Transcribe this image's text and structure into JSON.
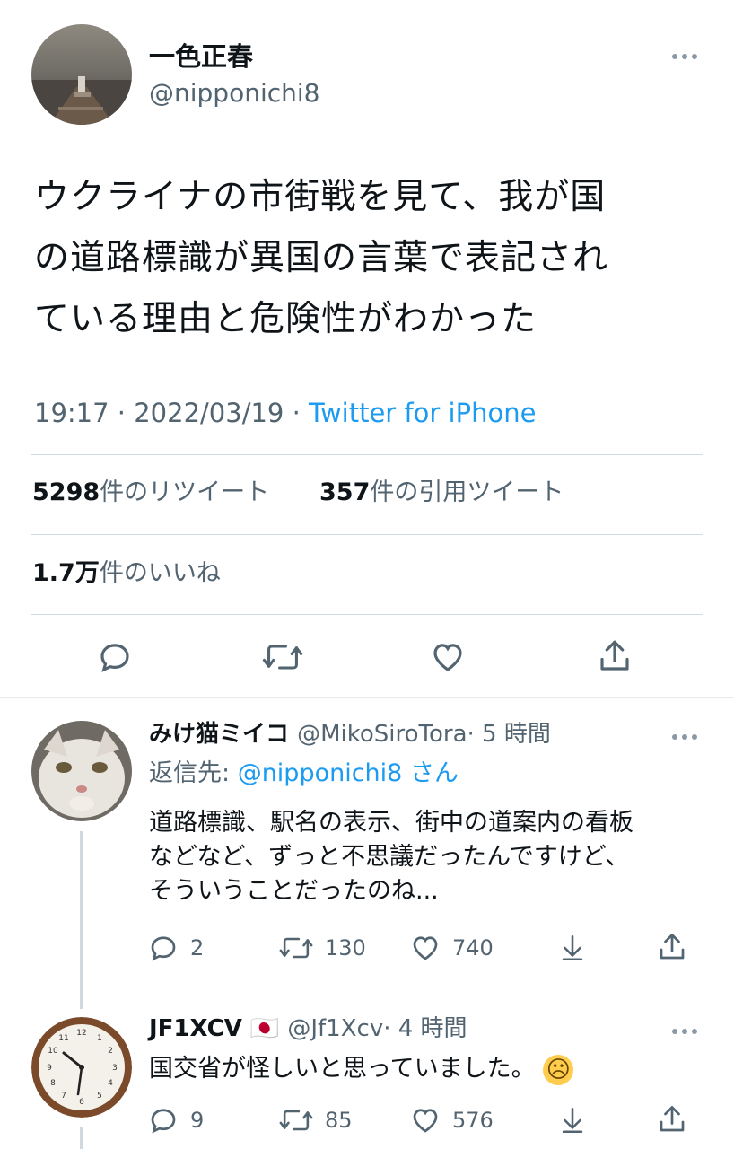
{
  "main_tweet": {
    "display_name": "一色正春",
    "handle": "@nipponichi8",
    "text_lines": [
      "ウクライナの市街戦を見て、我が国",
      "の道路標識が異国の言葉で表記され",
      "ている理由と危険性がわかった"
    ],
    "time": "19:17 · 2022/03/19 · ",
    "source": "Twitter for iPhone",
    "retweet_count": "5298",
    "retweet_label": "件のリツイート",
    "quote_count": "357",
    "quote_label": "件の引用ツイート",
    "like_count": "1.7万",
    "like_label": "件のいいね",
    "more_icon": "more-horizontal-icon"
  },
  "replies": [
    {
      "display_name": "みけ猫ミイコ",
      "handle": "@MikoSiroTora",
      "time": "· 5 時間",
      "reply_to_prefix": "返信先: ",
      "reply_to_handle": "@nipponichi8",
      "reply_to_suffix": " さん",
      "text_lines": [
        "道路標識、駅名の表示、街中の道案内の看板",
        "などなど、ずっと不思議だったんですけど、",
        "そういうことだったのね..."
      ],
      "replies": "2",
      "retweets": "130",
      "likes": "740"
    },
    {
      "display_name": "JF1XCV",
      "flag": "🇯🇵",
      "handle": "@Jf1Xcv",
      "time": "· 4 時間",
      "text": "国交省が怪しいと思っていました。",
      "emoji": "☹",
      "replies": "9",
      "retweets": "85",
      "likes": "576"
    }
  ],
  "colors": {
    "accent": "#1d9bf0",
    "secondary_text": "#536471",
    "divider": "#cfd9de"
  }
}
